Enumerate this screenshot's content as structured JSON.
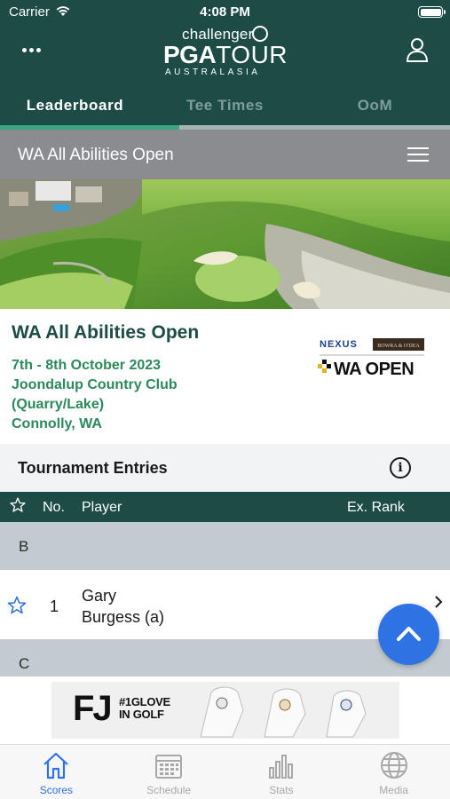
{
  "status_bar": {
    "carrier": "Carrier",
    "time": "4:08 PM"
  },
  "header": {
    "logo_line1": "challenger",
    "logo_pga": "PGA",
    "logo_tour": "TOUR",
    "logo_region": "AUSTRALASIA"
  },
  "tabs": [
    {
      "label": "Leaderboard",
      "active": true
    },
    {
      "label": "Tee Times",
      "active": false
    },
    {
      "label": "OoM",
      "active": false
    }
  ],
  "event_bar": {
    "title": "WA All Abilities Open"
  },
  "tournament": {
    "name": "WA All Abilities Open",
    "dates": "7th - 8th October 2023",
    "venue_line1": "Joondalup Country Club",
    "venue_line2": "(Quarry/Lake)",
    "location": "Connolly, WA",
    "sponsor_nexus": "NEXUS",
    "sponsor_bowra": "BOWRA & O'DEA",
    "sponsor_waopen": "WA OPEN"
  },
  "entries": {
    "heading": "Tournament Entries",
    "columns": {
      "no": "No.",
      "player": "Player",
      "rank": "Ex. Rank"
    },
    "groups": [
      {
        "letter": "B",
        "rows": [
          {
            "no": "1",
            "player_first": "Gary",
            "player_last": "Burgess (a)"
          }
        ]
      },
      {
        "letter": "C",
        "rows": []
      }
    ]
  },
  "ad": {
    "brand": "FJ",
    "tagline_line1": "#1GLOVE",
    "tagline_line2": "IN GOLF"
  },
  "tabbar": [
    {
      "label": "Scores",
      "icon": "home-icon",
      "active": true
    },
    {
      "label": "Schedule",
      "icon": "calendar-icon",
      "active": false
    },
    {
      "label": "Stats",
      "icon": "bar-chart-icon",
      "active": false
    },
    {
      "label": "Media",
      "icon": "globe-icon",
      "active": false
    }
  ],
  "colors": {
    "brand_green": "#1d4b45",
    "accent_green": "#3aa67f",
    "link_green": "#2b8a5c",
    "action_blue": "#2f72e4"
  }
}
